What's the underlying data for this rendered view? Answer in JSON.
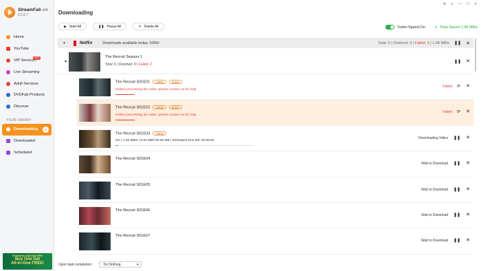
{
  "app": {
    "name": "StreamFab",
    "edition": "x64",
    "version": "6.0.0.7"
  },
  "window": {
    "title": "Downloading"
  },
  "sidebar": {
    "items": [
      {
        "label": "Home",
        "icon": "home-icon",
        "color": "#f6921e"
      },
      {
        "label": "YouTube",
        "icon": "youtube-icon",
        "color": "#e8403c"
      },
      {
        "label": "VIP Services",
        "icon": "vip-icon",
        "color": "#e8403c",
        "badge": "HOT"
      },
      {
        "label": "Live Streaming",
        "icon": "live-icon",
        "color": "#c93ac9"
      },
      {
        "label": "Adult Services",
        "icon": "adult-icon",
        "color": "#e8403c"
      },
      {
        "label": "DVDFab Products",
        "icon": "dvdfab-icon",
        "color": "#2b6ad1"
      },
      {
        "label": "Discover",
        "icon": "discover-icon",
        "color": "#2b6ad1"
      }
    ],
    "library_label": "YOUR LIBRARY",
    "library": [
      {
        "label": "Downloading",
        "icon": "download-icon",
        "count": "6"
      },
      {
        "label": "Downloaded",
        "icon": "downloaded-icon",
        "color": "#8a4cd9"
      },
      {
        "label": "Scheduled",
        "icon": "scheduled-icon",
        "color": "#8a4cd9"
      }
    ],
    "promo": {
      "line1": "Christmas Special Offer",
      "line2": "Buy One Get",
      "line3": "All-in-One FREE!"
    }
  },
  "toolbar": {
    "start_all": "Start All",
    "pause_all": "Pause All",
    "delete_all": "Delete All"
  },
  "turbo": {
    "label": "Turbo-Speed On",
    "enabled": true
  },
  "total_speed": "Total Speed 1.08 MB/s",
  "group": {
    "service": "Netflix",
    "downloads_available": "Downloads available today: 50/50",
    "total": "Total: 6",
    "finished": "Finished: 0",
    "failed": "Failed: 2",
    "speed": "1.08 MB/s"
  },
  "season": {
    "title": "The Recruit  Season 1",
    "total": "Total: 6",
    "finished": "Finished: 0",
    "failed": "Failed: 2"
  },
  "episodes": [
    {
      "title": "The Recruit S01E01",
      "tags": [
        "1080p",
        "60min"
      ],
      "error": "Failure processing the video, please contact us for help.",
      "status": "Failed"
    },
    {
      "title": "The Recruit S01E02",
      "tags": [
        "1080p",
        "66min"
      ],
      "error": "Failure processing the video, please contact us for help.",
      "status": "Failed"
    },
    {
      "title": "The Recruit S01E03",
      "tags": [
        "1080p"
      ],
      "progress_text": "0%  |  1.35 MB/s  |  5.82 MB/720.83 MB  |  Estimated time left: 00:06:50",
      "progress": 0.02,
      "status": "Downloading Video"
    },
    {
      "title": "The Recruit S01E04",
      "status": "Wait to Download"
    },
    {
      "title": "The Recruit S01E05",
      "status": "Wait to Download"
    },
    {
      "title": "The Recruit S01E06",
      "status": "Wait to Download"
    },
    {
      "title": "The Recruit S01E07",
      "status": "Wait to Download"
    }
  ],
  "footer": {
    "label": "Upon task completion:",
    "option": "Do Nothing"
  }
}
